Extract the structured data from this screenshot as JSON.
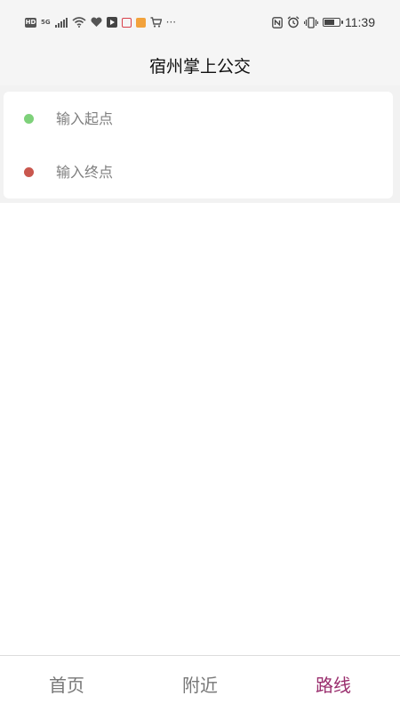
{
  "status_bar": {
    "time": "11:39",
    "network_label": "5G",
    "overflow": "···",
    "battery_level": 0.75
  },
  "header": {
    "title": "宿州掌上公交"
  },
  "route_search": {
    "start_placeholder": "输入起点",
    "end_placeholder": "输入终点",
    "start_dot_color": "#7ed17a",
    "end_dot_color": "#c9574e"
  },
  "bottom_nav": {
    "tabs": [
      {
        "label": "首页"
      },
      {
        "label": "附近"
      },
      {
        "label": "路线"
      }
    ],
    "active_index": 2,
    "active_color": "#9a2f6e"
  }
}
